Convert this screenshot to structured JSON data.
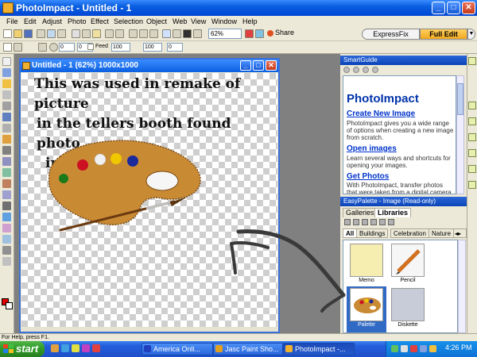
{
  "app": {
    "title": "PhotoImpact - Untitled - 1",
    "window_buttons": {
      "minimize": "_",
      "maximize": "□",
      "close": "✕"
    }
  },
  "menu": [
    "File",
    "Edit",
    "Adjust",
    "Photo",
    "Effect",
    "Selection",
    "Object",
    "Web",
    "View",
    "Window",
    "Help"
  ],
  "toolbar": {
    "zoom_value": "62%",
    "share_label": "Share",
    "expressfix_label": "ExpressFix",
    "fulledit_label": "Full Edit",
    "field_a": "0",
    "field_b": "0",
    "feed_label": "Feed",
    "field_c": "100",
    "field_d": "100",
    "field_e": "0"
  },
  "image_window": {
    "title": "Untitled - 1 (62%) 1000x1000",
    "caption_lines": [
      "This was used in remake of picture",
      "in the tellers booth found photo",
      "impact images"
    ]
  },
  "smartguide": {
    "header": "SmartGuide",
    "heading": "PhotoImpact",
    "items": [
      {
        "title": "Create New Image",
        "desc": "PhotoImpact gives you a wide range of options when creating a new image from scratch."
      },
      {
        "title": "Open images",
        "desc": "Learn several ways and shortcuts for opening your images."
      },
      {
        "title": "Get Photos",
        "desc": "With PhotoImpact, transfer photos that were taken from a digital camera"
      }
    ]
  },
  "easypalette": {
    "header": "EasyPalette - Image (Read-only)",
    "tabs": [
      "Galleries",
      "Libraries"
    ],
    "active_tab": "Libraries",
    "categories": [
      "All",
      "Buildings",
      "Celebration",
      "Nature"
    ],
    "items": [
      {
        "label": "Memo"
      },
      {
        "label": "Pencil"
      },
      {
        "label": "Palette",
        "selected": true
      },
      {
        "label": "Diskette"
      }
    ]
  },
  "statusbar": {
    "text": "For Help, press F1."
  },
  "taskbar": {
    "start_label": "start",
    "tasks": [
      {
        "label": "America Onli..."
      },
      {
        "label": "Jasc Paint Sho..."
      },
      {
        "label": "PhotoImpact -..."
      }
    ],
    "clock": "4:26 PM"
  },
  "colors": {
    "title_blue": "#0a5fe0",
    "accent_orange": "#f0a820",
    "link_blue": "#0033cc",
    "selection_blue": "#316ac5"
  }
}
